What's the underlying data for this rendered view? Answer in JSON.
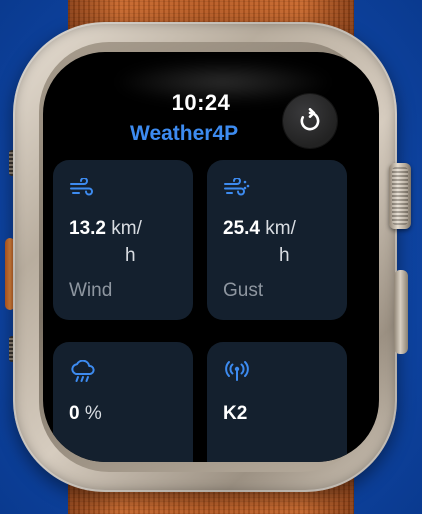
{
  "status_bar": {
    "time": "10:24"
  },
  "app": {
    "name": "Weather4P"
  },
  "cards": [
    {
      "icon": "wind-icon",
      "value": "13.2",
      "unit_top": "km/",
      "unit_bottom": "h",
      "label": "Wind"
    },
    {
      "icon": "gust-icon",
      "value": "25.4",
      "unit_top": "km/",
      "unit_bottom": "h",
      "label": "Gust"
    },
    {
      "icon": "rain-cloud-icon",
      "value": "0",
      "unit_top": "%",
      "unit_bottom": "",
      "label": ""
    },
    {
      "icon": "station-antenna-icon",
      "value": "K2",
      "unit_top": "",
      "unit_bottom": "",
      "label": ""
    }
  ],
  "colors": {
    "accent": "#3D8BF0",
    "card_background": "#14202E",
    "background": "#0F46A6",
    "band": "#B85A22"
  }
}
